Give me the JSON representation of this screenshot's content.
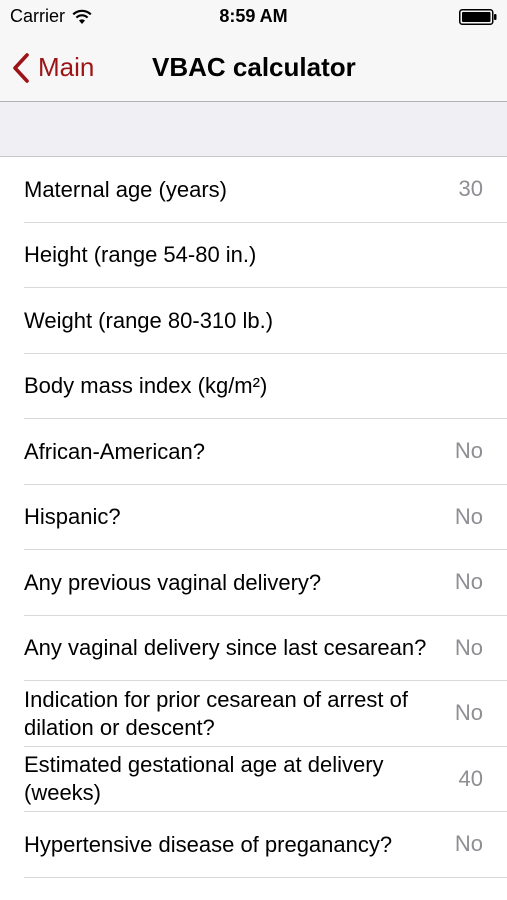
{
  "status_bar": {
    "carrier": "Carrier",
    "time": "8:59 AM"
  },
  "nav": {
    "back_label": "Main",
    "title": "VBAC calculator",
    "accent_color": "#9c1416"
  },
  "form": {
    "rows": [
      {
        "label": "Maternal age (years)",
        "value": "30"
      },
      {
        "label": "Height (range 54-80 in.)",
        "value": ""
      },
      {
        "label": "Weight (range 80-310 lb.)",
        "value": ""
      },
      {
        "label": "Body mass index (kg/m²)",
        "value": ""
      },
      {
        "label": "African-American?",
        "value": "No"
      },
      {
        "label": "Hispanic?",
        "value": "No"
      },
      {
        "label": "Any previous vaginal delivery?",
        "value": "No"
      },
      {
        "label": "Any vaginal delivery since last cesarean?",
        "value": "No"
      },
      {
        "label": "Indication for prior cesarean of arrest of dilation or descent?",
        "value": "No"
      },
      {
        "label": "Estimated gestational age at delivery (weeks)",
        "value": "40"
      },
      {
        "label": "Hypertensive disease of preganancy?",
        "value": "No"
      }
    ]
  }
}
